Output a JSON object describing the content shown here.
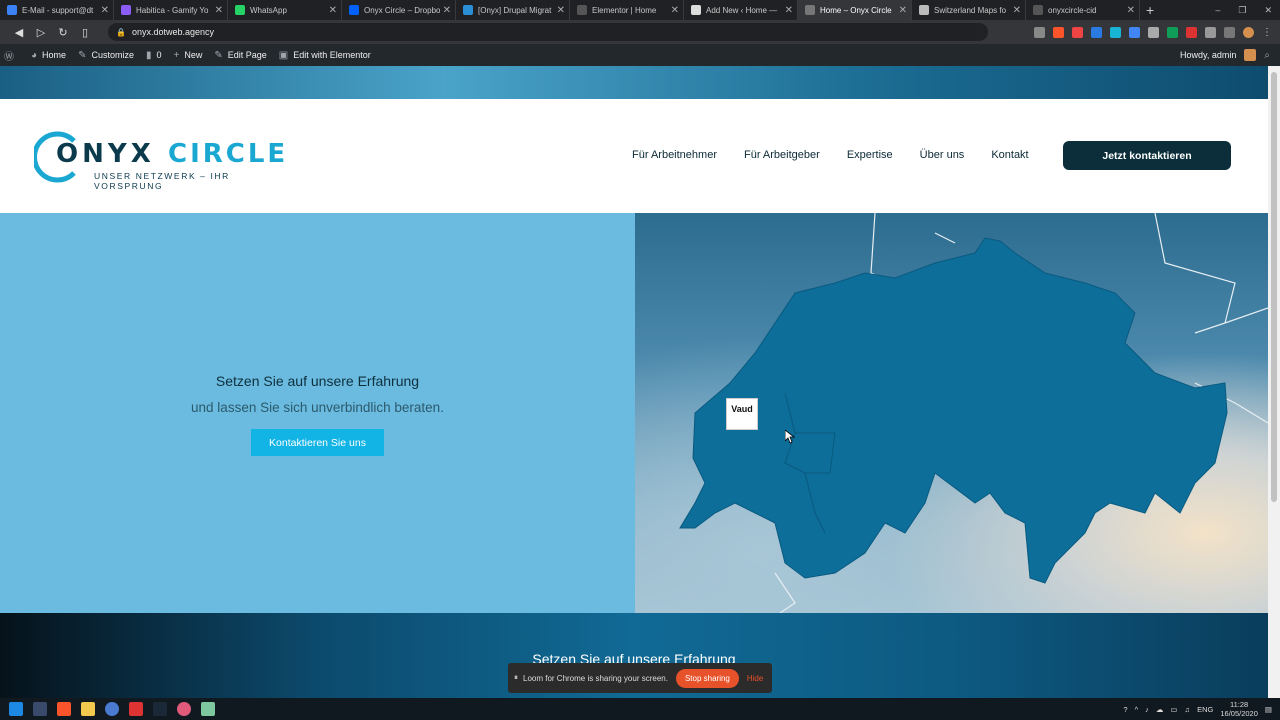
{
  "browser": {
    "tabs": [
      {
        "label": "E-Mail - support@dt",
        "color": "#3b82f6",
        "active": false
      },
      {
        "label": "Habitica - Gamify Yo",
        "color": "#8b5cf6",
        "active": false
      },
      {
        "label": "WhatsApp",
        "color": "#25d366",
        "active": false
      },
      {
        "label": "Onyx Circle – Dropbo",
        "color": "#0061fe",
        "active": false
      },
      {
        "label": "[Onyx] Drupal Migrat",
        "color": "#2b8fd6",
        "active": false
      },
      {
        "label": "Elementor | Home",
        "color": "#555555",
        "active": false
      },
      {
        "label": "Add New ‹ Home —",
        "color": "#dddddd",
        "active": false
      },
      {
        "label": "Home – Onyx Circle",
        "color": "#777777",
        "active": true
      },
      {
        "label": "Switzerland Maps fo",
        "color": "#bbbbbb",
        "active": false
      },
      {
        "label": "onyxcircle-cid",
        "color": "#555555",
        "active": false
      }
    ],
    "url": "onyx.dotweb.agency"
  },
  "wp_admin_bar": {
    "home": "Home",
    "customize": "Customize",
    "comments": "0",
    "new": "New",
    "edit_page": "Edit Page",
    "edit_elementor": "Edit with Elementor",
    "howdy": "Howdy, admin"
  },
  "site": {
    "logo": {
      "word1": "ONYX",
      "word2": "CIRCLE",
      "tagline": "UNSER NETZWERK – IHR VORSPRUNG"
    },
    "nav": [
      "Für Arbeitnehmer",
      "Für Arbeitgeber",
      "Expertise",
      "Über uns",
      "Kontakt"
    ],
    "cta": "Jetzt kontaktieren",
    "hero": {
      "title": "Setzen Sie auf unsere Erfahrung",
      "subtitle": "und lassen Sie sich unverbindlich beraten.",
      "button": "Kontaktieren Sie uns"
    },
    "map_tooltip": "Vaud",
    "section2_title": "Setzen Sie auf unsere Erfahrung"
  },
  "loom": {
    "message": "Loom for Chrome is sharing your screen.",
    "stop": "Stop sharing",
    "hide": "Hide"
  },
  "taskbar": {
    "lang": "ENG",
    "time": "11:28",
    "date": "16/05/2020"
  },
  "colors": {
    "brand_dark": "#0b2e3a",
    "brand_cyan": "#1aa7d1",
    "hero_bg": "#6bbbe0",
    "map_fill": "#0d6e9a"
  }
}
